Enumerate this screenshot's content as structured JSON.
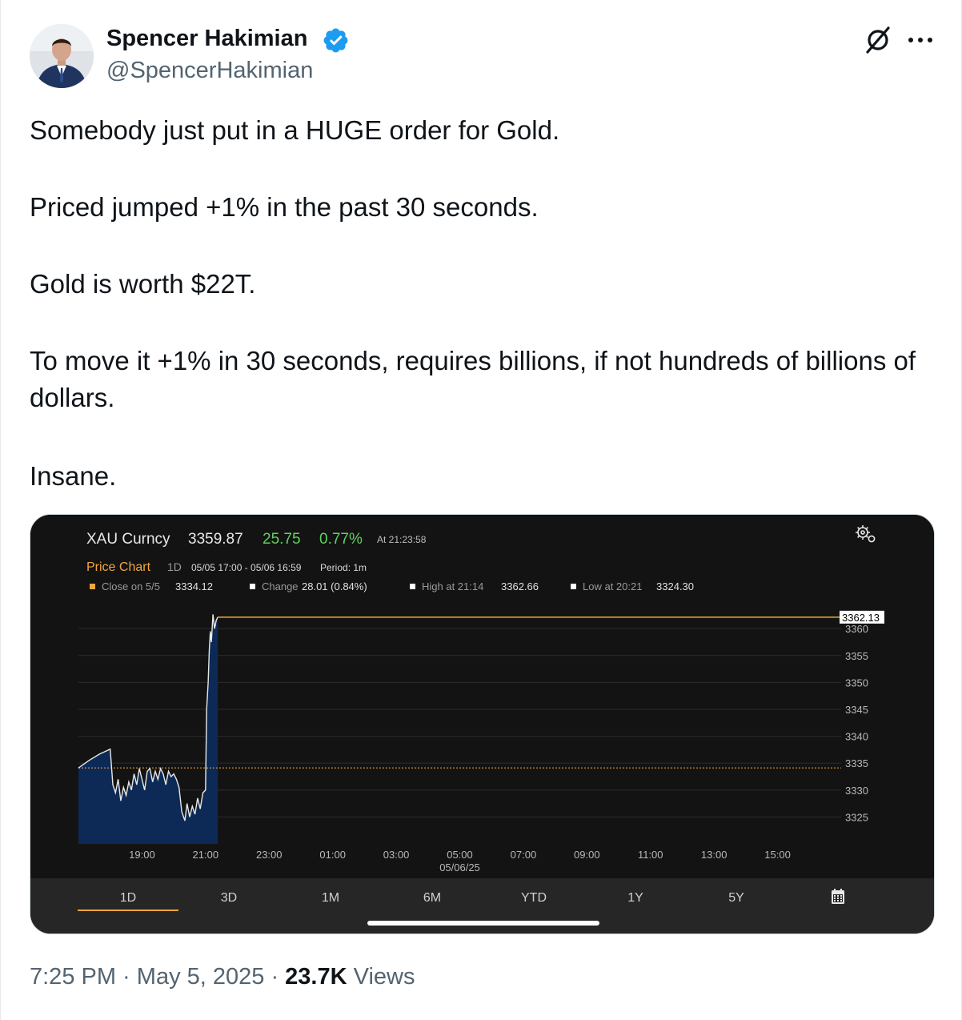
{
  "author": {
    "name": "Spencer Hakimian",
    "handle": "@SpencerHakimian"
  },
  "icons": {
    "avatar": "profile-photo",
    "verified": "verified-badge-icon",
    "grok": "grok-icon",
    "more": "more-options-icon",
    "settings": "gear-icon",
    "calendar": "calendar-icon"
  },
  "tweet": {
    "paragraphs": [
      "Somebody just put in a HUGE order for Gold.",
      "Priced jumped +1% in the past 30 seconds.",
      "Gold is worth $22T.",
      "To move it +1% in 30 seconds, requires billions, if not hundreds of billions of dollars.",
      "Insane."
    ]
  },
  "footer": {
    "time": "7:25 PM",
    "sep1": " · ",
    "date": "May 5, 2025",
    "sep2": " · ",
    "views_count": "23.7K",
    "views_label": " Views"
  },
  "colors": {
    "verified": "#1d9bf0",
    "chart_bg": "#131313",
    "chart_line": "#e8e8e8",
    "chart_fill": "#0c2a55",
    "reference_line": "#f0a640",
    "up_green": "#5fd35f",
    "header_orange": "#f0a640"
  },
  "terminal": {
    "ticker": "XAU Curncy",
    "last": "3359.87",
    "change": "25.75",
    "change_pct": "0.77%",
    "time": "At 21:23:58",
    "chart_title": "Price Chart",
    "period_label": "1D",
    "range": "05/05 17:00 - 05/06 16:59",
    "period": "Period: 1m",
    "stats": [
      {
        "label": "Close on 5/5",
        "value": "3334.12",
        "marker": "orange"
      },
      {
        "label": "Change",
        "value": "28.01 (0.84%)",
        "marker": "white"
      },
      {
        "label": "High at 21:14",
        "value": "3362.66",
        "marker": "white"
      },
      {
        "label": "Low at 20:21",
        "value": "3324.30",
        "marker": "white"
      }
    ],
    "last_price_tag": "3362.13",
    "date_sublabel": "05/06/25",
    "tabs": [
      "1D",
      "3D",
      "1M",
      "6M",
      "YTD",
      "1Y",
      "5Y"
    ],
    "active_tab": "1D"
  },
  "chart_data": {
    "type": "area",
    "title": "",
    "xlabel": "",
    "ylabel": "",
    "x_ticks": [
      "19:00",
      "21:00",
      "23:00",
      "01:00",
      "03:00",
      "05:00",
      "07:00",
      "09:00",
      "11:00",
      "13:00",
      "15:00"
    ],
    "y_ticks": [
      3325,
      3330,
      3335,
      3340,
      3345,
      3350,
      3355,
      3360
    ],
    "ylim": [
      3320,
      3363
    ],
    "reference_line": 3334.12,
    "series": [
      {
        "values": [
          [
            "17:00",
            3334.1
          ],
          [
            "17:20",
            3335.5
          ],
          [
            "17:40",
            3336.7
          ],
          [
            "18:00",
            3337.6
          ],
          [
            "18:05",
            3331.0
          ],
          [
            "18:10",
            3329.5
          ],
          [
            "18:15",
            3332.0
          ],
          [
            "18:20",
            3328.0
          ],
          [
            "18:25",
            3330.5
          ],
          [
            "18:30",
            3329.0
          ],
          [
            "18:35",
            3331.5
          ],
          [
            "18:40",
            3330.0
          ],
          [
            "18:45",
            3333.0
          ],
          [
            "18:50",
            3331.0
          ],
          [
            "18:55",
            3334.0
          ],
          [
            "19:00",
            3332.0
          ],
          [
            "19:05",
            3330.0
          ],
          [
            "19:10",
            3333.5
          ],
          [
            "19:15",
            3334.0
          ],
          [
            "19:20",
            3331.5
          ],
          [
            "19:25",
            3333.5
          ],
          [
            "19:30",
            3332.0
          ],
          [
            "19:35",
            3334.0
          ],
          [
            "19:40",
            3333.0
          ],
          [
            "19:45",
            3331.0
          ],
          [
            "19:50",
            3333.5
          ],
          [
            "19:55",
            3332.5
          ],
          [
            "20:00",
            3333.0
          ],
          [
            "20:05",
            3332.0
          ],
          [
            "20:10",
            3330.5
          ],
          [
            "20:15",
            3326.0
          ],
          [
            "20:21",
            3324.3
          ],
          [
            "20:25",
            3327.5
          ],
          [
            "20:30",
            3325.0
          ],
          [
            "20:35",
            3327.0
          ],
          [
            "20:40",
            3325.5
          ],
          [
            "20:45",
            3328.5
          ],
          [
            "20:50",
            3326.5
          ],
          [
            "20:55",
            3329.5
          ],
          [
            "21:00",
            3330.0
          ],
          [
            "21:02",
            3345.0
          ],
          [
            "21:05",
            3350.0
          ],
          [
            "21:07",
            3356.0
          ],
          [
            "21:09",
            3359.5
          ],
          [
            "21:11",
            3357.5
          ],
          [
            "21:14",
            3362.66
          ],
          [
            "21:17",
            3360.0
          ],
          [
            "21:20",
            3361.5
          ],
          [
            "21:23",
            3362.13
          ]
        ]
      }
    ]
  }
}
